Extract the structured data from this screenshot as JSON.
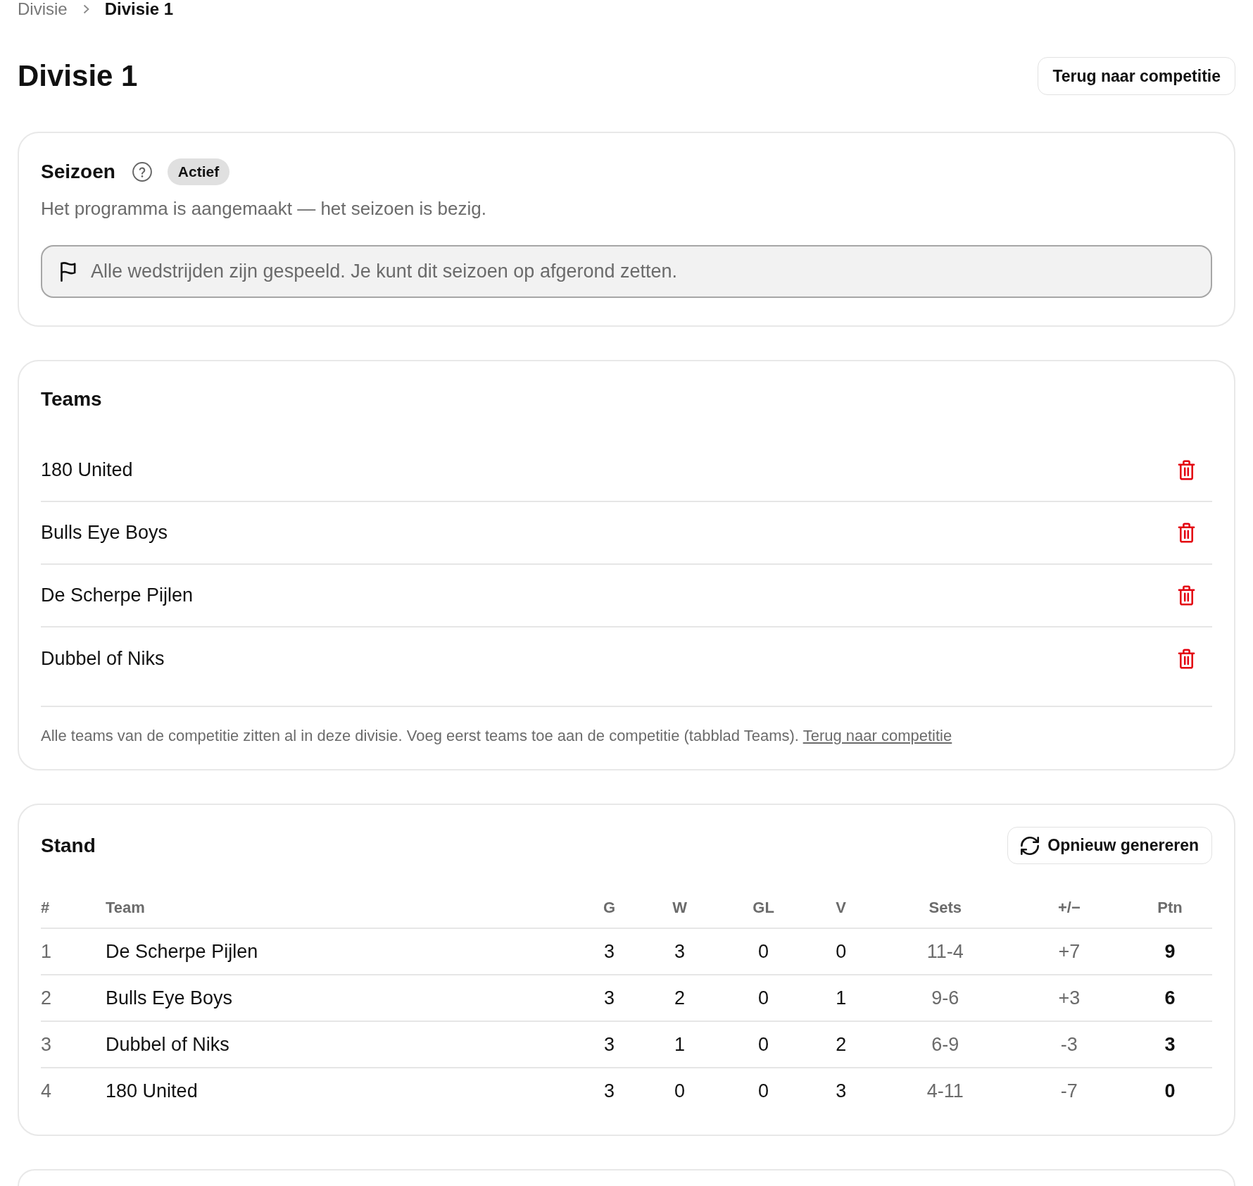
{
  "breadcrumb": [
    {
      "label": "Divisie",
      "current": false
    },
    {
      "label": "Divisie 1",
      "current": true
    }
  ],
  "header": {
    "title": "Divisie 1",
    "button": "Terug naar competitie"
  },
  "season": {
    "title": "Seizoen",
    "status": "Actief",
    "description": "Het programma is aangemaakt — het seizoen is bezig.",
    "alert": "Alle wedstrijden zijn gespeeld. Je kunt dit seizoen op afgerond zetten."
  },
  "teams": {
    "title": "Teams",
    "items": [
      {
        "name": "180 United"
      },
      {
        "name": "Bulls Eye Boys"
      },
      {
        "name": "De Scherpe Pijlen"
      },
      {
        "name": "Dubbel of Niks"
      }
    ],
    "note": "Alle teams van de competitie zitten al in deze divisie. Voeg eerst teams toe aan de competitie (tabblad Teams).",
    "note_link": "Terug naar competitie"
  },
  "standings": {
    "title": "Stand",
    "button": "Opnieuw genereren",
    "columns": [
      {
        "label": "#",
        "kind": "rank"
      },
      {
        "label": "Team",
        "kind": "team"
      },
      {
        "label": "G",
        "kind": "stat"
      },
      {
        "label": "W",
        "kind": "stat"
      },
      {
        "label": "GL",
        "kind": "stat"
      },
      {
        "label": "V",
        "kind": "stat"
      },
      {
        "label": "Sets",
        "kind": "muted"
      },
      {
        "label": "+/−",
        "kind": "muted"
      },
      {
        "label": "Ptn",
        "kind": "points"
      }
    ],
    "rows": [
      {
        "cells": [
          "1",
          "De Scherpe Pijlen",
          "3",
          "3",
          "0",
          "0",
          "11-4",
          "+7",
          "9"
        ]
      },
      {
        "cells": [
          "2",
          "Bulls Eye Boys",
          "3",
          "2",
          "0",
          "1",
          "9-6",
          "+3",
          "6"
        ]
      },
      {
        "cells": [
          "3",
          "Dubbel of Niks",
          "3",
          "1",
          "0",
          "2",
          "6-9",
          "-3",
          "3"
        ]
      },
      {
        "cells": [
          "4",
          "180 United",
          "3",
          "0",
          "0",
          "3",
          "4-11",
          "-7",
          "0"
        ]
      }
    ]
  }
}
